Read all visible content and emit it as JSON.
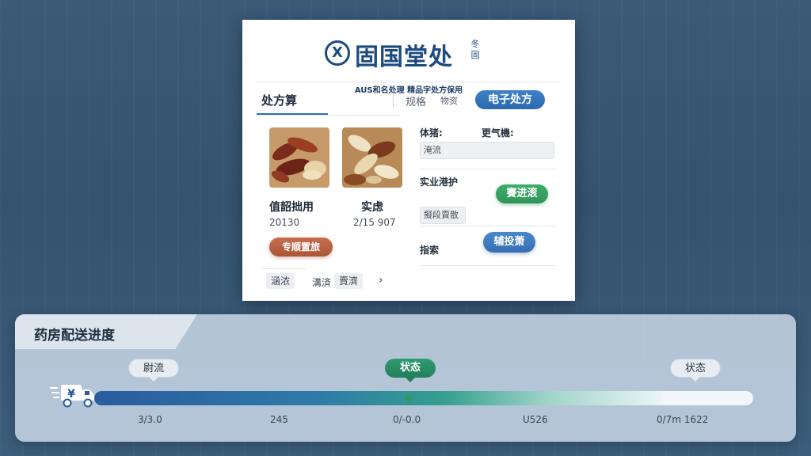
{
  "prescription": {
    "logo_mark": "X",
    "logo_title": "固国堂处",
    "logo_side": "冬固",
    "logo_subtitle": "AUS和名处理 精品字处方保用",
    "tabs": {
      "main": "处方算",
      "second": "规格",
      "third": "物资",
      "active_pill": "电子处方"
    },
    "herbs": [
      {
        "name": "值韶拙用",
        "number": "20130"
      },
      {
        "name": "实虑",
        "number": "2/15 907"
      }
    ],
    "chip_orange": "专顺置旅",
    "bottom_chips": [
      "涵浓",
      "溝済",
      "賣濟"
    ],
    "bottom_arrow": "›",
    "right": {
      "label_a": "体猪:",
      "label_b": "更气機:",
      "field_a": "淹流",
      "label_c": "实业港护",
      "pill_green": "賽进滚",
      "field_b": "擬段賣散",
      "label_d": "指索",
      "pill_blue": "辅投萧"
    },
    "colors": {
      "brand": "#1c4b80",
      "pill_blue": "#2f6fb3",
      "pill_green": "#34a263",
      "chip_orange": "#b85e3f"
    }
  },
  "delivery": {
    "title": "药房配送进度",
    "progress_fraction": 0.86,
    "stage_labels": [
      "尉流",
      "状态",
      "状态"
    ],
    "ticks": [
      "3/3.0",
      "245",
      "0/-0.0",
      "U526",
      "0/7m 1622"
    ],
    "icons": {
      "truck": "truck-icon",
      "currency": "¥"
    },
    "colors": {
      "track_start": "#2a5b9e",
      "track_mid": "#36a08e",
      "active_stage": "#2c9a6c"
    }
  }
}
